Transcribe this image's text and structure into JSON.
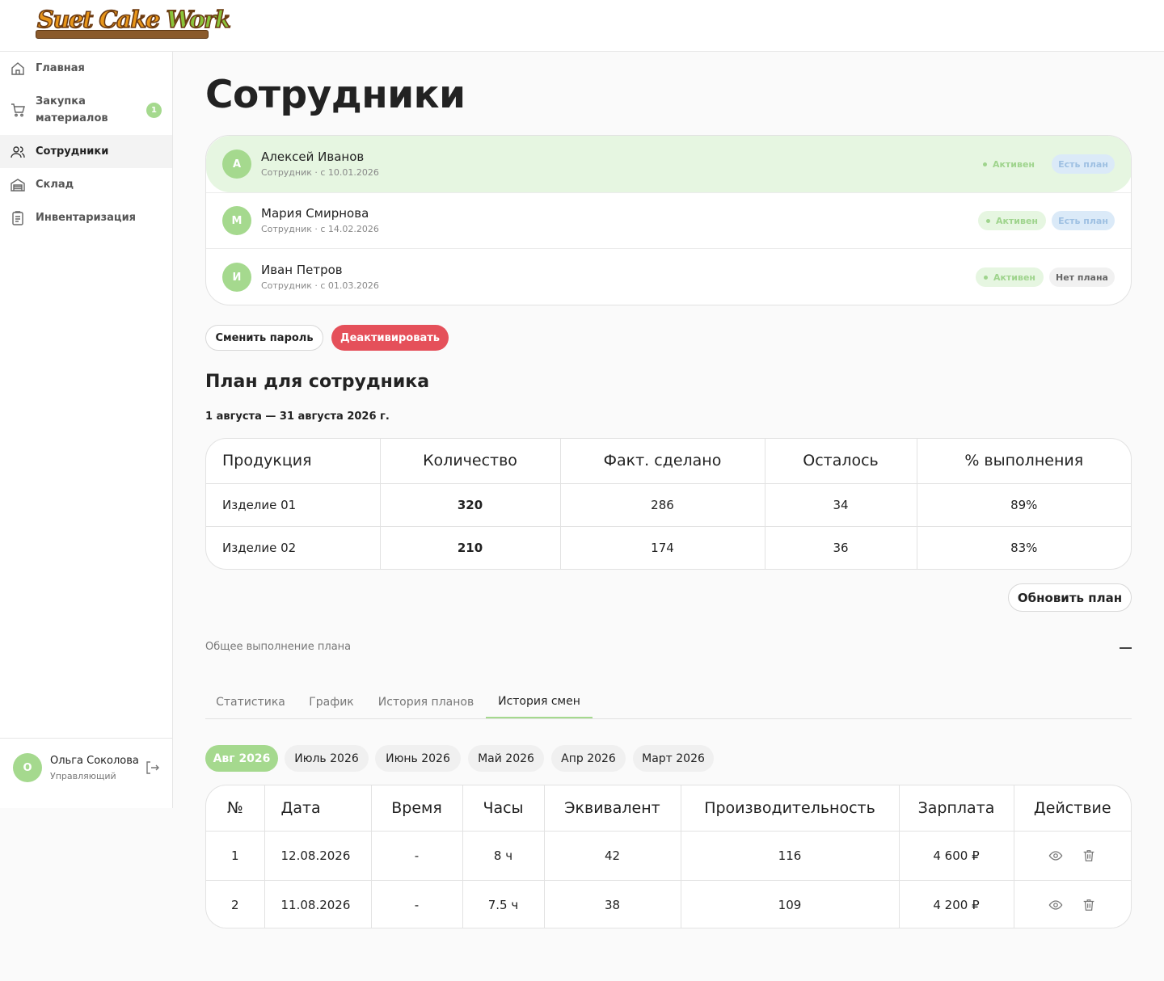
{
  "brand": {
    "logo_text_1": "Suet Cake ",
    "logo_text_2": "Work"
  },
  "nav": {
    "items": [
      {
        "label": "Главная",
        "icon": "home-icon"
      },
      {
        "label": "Закупка материалов",
        "line1": "Закупка",
        "line2": "материалов",
        "icon": "cart-icon",
        "badge": "1"
      },
      {
        "label": "Сотрудники",
        "icon": "users-icon",
        "active": true
      },
      {
        "label": "Склад",
        "icon": "warehouse-icon"
      },
      {
        "label": "Инвентаризация",
        "icon": "clipboard-icon"
      }
    ]
  },
  "user": {
    "initial": "О",
    "name": "Ольга Соколова",
    "role": "Управляющий"
  },
  "page": {
    "title": "Сотрудники"
  },
  "employees": [
    {
      "initial": "А",
      "name": "Алексей Иванов",
      "sub": "Сотрудник · с 10.01.2026",
      "status": "Активен",
      "plan": "Есть план",
      "selected": true
    },
    {
      "initial": "М",
      "name": "Мария Смирнова",
      "sub": "Сотрудник · с 14.02.2026",
      "status": "Активен",
      "plan": "Есть план"
    },
    {
      "initial": "И",
      "name": "Иван Петров",
      "sub": "Сотрудник · с 01.03.2026",
      "status": "Активен",
      "plan": "Нет плана"
    }
  ],
  "actions": {
    "change_password": "Сменить пароль",
    "deactivate": "Деактивировать"
  },
  "plan": {
    "title": "План для сотрудника",
    "period": "1 августа — 31 августа 2026 г.",
    "columns": [
      "Продукция",
      "Количество",
      "Факт. сделано",
      "Осталось",
      "% выполнения"
    ],
    "rows": [
      [
        "Изделие 01",
        "320",
        "286",
        "34",
        "89%"
      ],
      [
        "Изделие 02",
        "210",
        "174",
        "36",
        "83%"
      ]
    ],
    "update_label": "Обновить план",
    "overall_label": "Общее выполнение плана"
  },
  "tabs": [
    "Статистика",
    "График",
    "История планов",
    "История смен"
  ],
  "active_tab": "История смен",
  "months": [
    "Авг 2026",
    "Июль 2026",
    "Июнь 2026",
    "Май 2026",
    "Апр 2026",
    "Март 2026"
  ],
  "shifts": {
    "columns": [
      "№",
      "Дата",
      "Время",
      "Часы",
      "Эквивалент",
      "Производительность",
      "Зарплата",
      "Действие"
    ],
    "rows": [
      [
        "1",
        "12.08.2026",
        "-",
        "8 ч",
        "42",
        "116",
        "4 600 ₽"
      ],
      [
        "2",
        "11.08.2026",
        "-",
        "7.5 ч",
        "38",
        "109",
        "4 200 ₽"
      ]
    ]
  },
  "colors": {
    "accent": "#a5d98e",
    "selected_row": "#e6f6e1",
    "danger": "#e5505a",
    "plan_badge": "#dbeaf8"
  }
}
